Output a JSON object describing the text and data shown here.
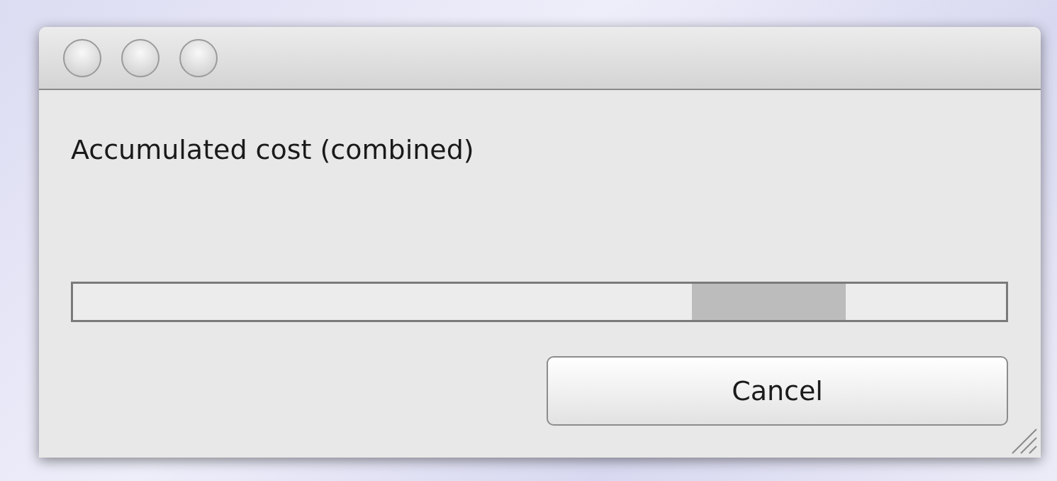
{
  "dialog": {
    "message": "Accumulated cost (combined)",
    "progress": {
      "indeterminate": true
    },
    "buttons": [
      {
        "label": "Cancel",
        "kind": "default"
      }
    ]
  }
}
